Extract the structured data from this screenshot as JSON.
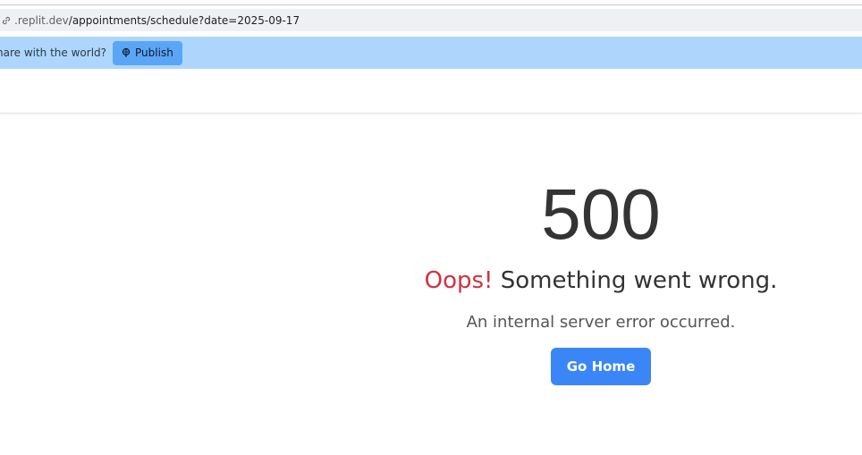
{
  "browser": {
    "url_host": ".replit.dev",
    "url_path": "/appointments/schedule?date=2025-09-17"
  },
  "banner": {
    "text": "hare with the world?",
    "publish_label": "Publish",
    "publish_icon": "globe-pin-icon",
    "color": "#aed6fd",
    "button_color": "#5aa6f6"
  },
  "error": {
    "code": "500",
    "title_accent": "Oops!",
    "title_rest": " Something went wrong.",
    "message": "An internal server error occurred.",
    "button_label": "Go Home",
    "accent_color": "#d1323f",
    "button_color": "#3b86f6"
  }
}
